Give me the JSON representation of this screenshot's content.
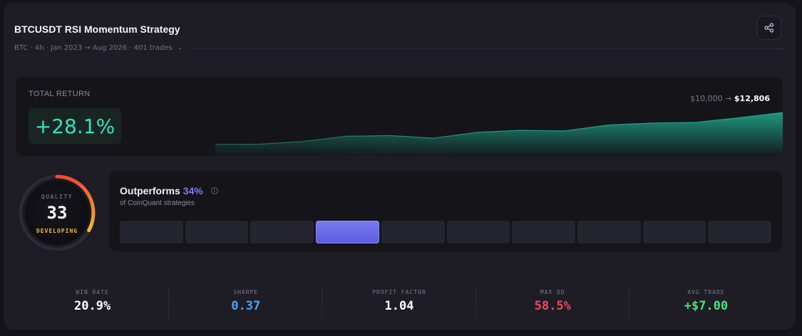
{
  "header": {
    "title": "BTCUSDT RSI Momentum Strategy",
    "subtitle": "BTC · 4h · Jan 2023 → Aug 2026 · 401 trades",
    "share_icon": "share-icon"
  },
  "total_return": {
    "label": "TOTAL RETURN",
    "value": "+28.1%",
    "equity_start": "$10,000 →",
    "equity_end": "$12,806",
    "sparkline": [
      0.55,
      0.58,
      1.0,
      1.8,
      1.9,
      1.5,
      2.4,
      2.7,
      2.6,
      3.5,
      3.8,
      3.9,
      4.6,
      5.4
    ]
  },
  "quality": {
    "label": "QUALITY",
    "score": "33",
    "tier": "DEVELOPING",
    "fraction": 0.33,
    "colors": {
      "start": "#f24a33",
      "end": "#f5b82e"
    }
  },
  "outperform": {
    "title": "Outperforms",
    "percent": "34%",
    "subtitle": "of CoinQuant strategies",
    "bins": 10,
    "active_bin": 3,
    "info_icon": "info-icon"
  },
  "stats": [
    {
      "label": "WIN RATE",
      "value": "20.9%",
      "color": "#ffffff"
    },
    {
      "label": "SHARPE",
      "value": "0.37",
      "color": "#4aa3f5"
    },
    {
      "label": "PROFIT FACTOR",
      "value": "1.04",
      "color": "#ffffff"
    },
    {
      "label": "MAX DD",
      "value": "58.5%",
      "color": "#f2485e"
    },
    {
      "label": "AVG TRADE",
      "value": "+$7.00",
      "color": "#4ee07a"
    }
  ],
  "colors": {
    "accent_teal": "#2fe3c2",
    "accent_indigo": "#7b7ef2"
  }
}
